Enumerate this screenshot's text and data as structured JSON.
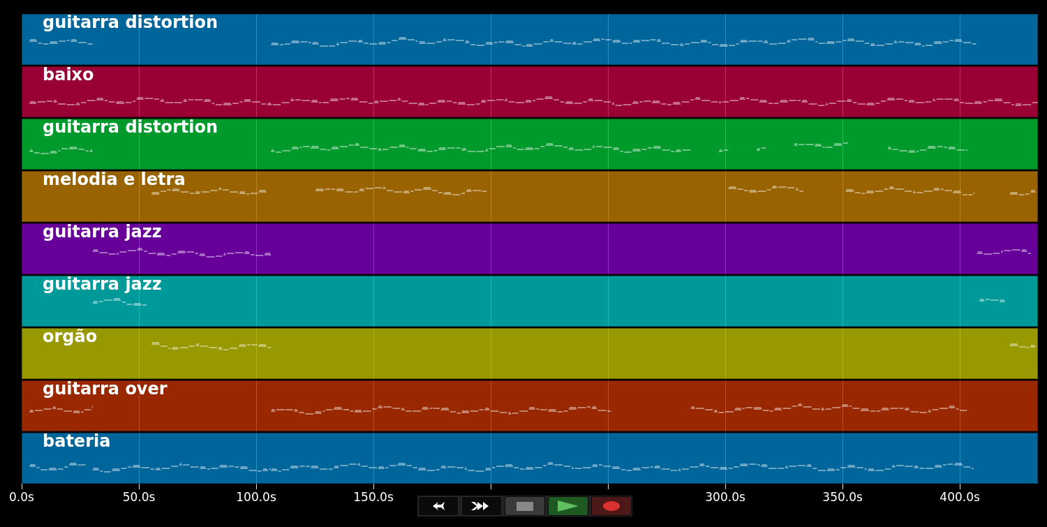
{
  "tracks": [
    {
      "name": "guitarra distortion",
      "color": "#00659a"
    },
    {
      "name": "baixo",
      "color": "#990033"
    },
    {
      "name": "guitarra distortion",
      "color": "#00992c"
    },
    {
      "name": "melodia e letra",
      "color": "#986300"
    },
    {
      "name": "guitarra jazz",
      "color": "#660099"
    },
    {
      "name": "guitarra jazz",
      "color": "#009999"
    },
    {
      "name": "orgão",
      "color": "#989900"
    },
    {
      "name": "guitarra over",
      "color": "#992800"
    },
    {
      "name": "bateria",
      "color": "#00659a"
    }
  ],
  "time_axis": {
    "labels_from_start": [
      "0.0s",
      "50.0s",
      "100.0s",
      "150.0s"
    ],
    "labels_to_end": [
      "300.0s",
      "350.0s",
      "400.0s"
    ]
  },
  "transport": [
    {
      "kind": "rewind"
    },
    {
      "kind": "fast-forward"
    },
    {
      "kind": "stop"
    },
    {
      "kind": "play"
    },
    {
      "kind": "record"
    }
  ]
}
